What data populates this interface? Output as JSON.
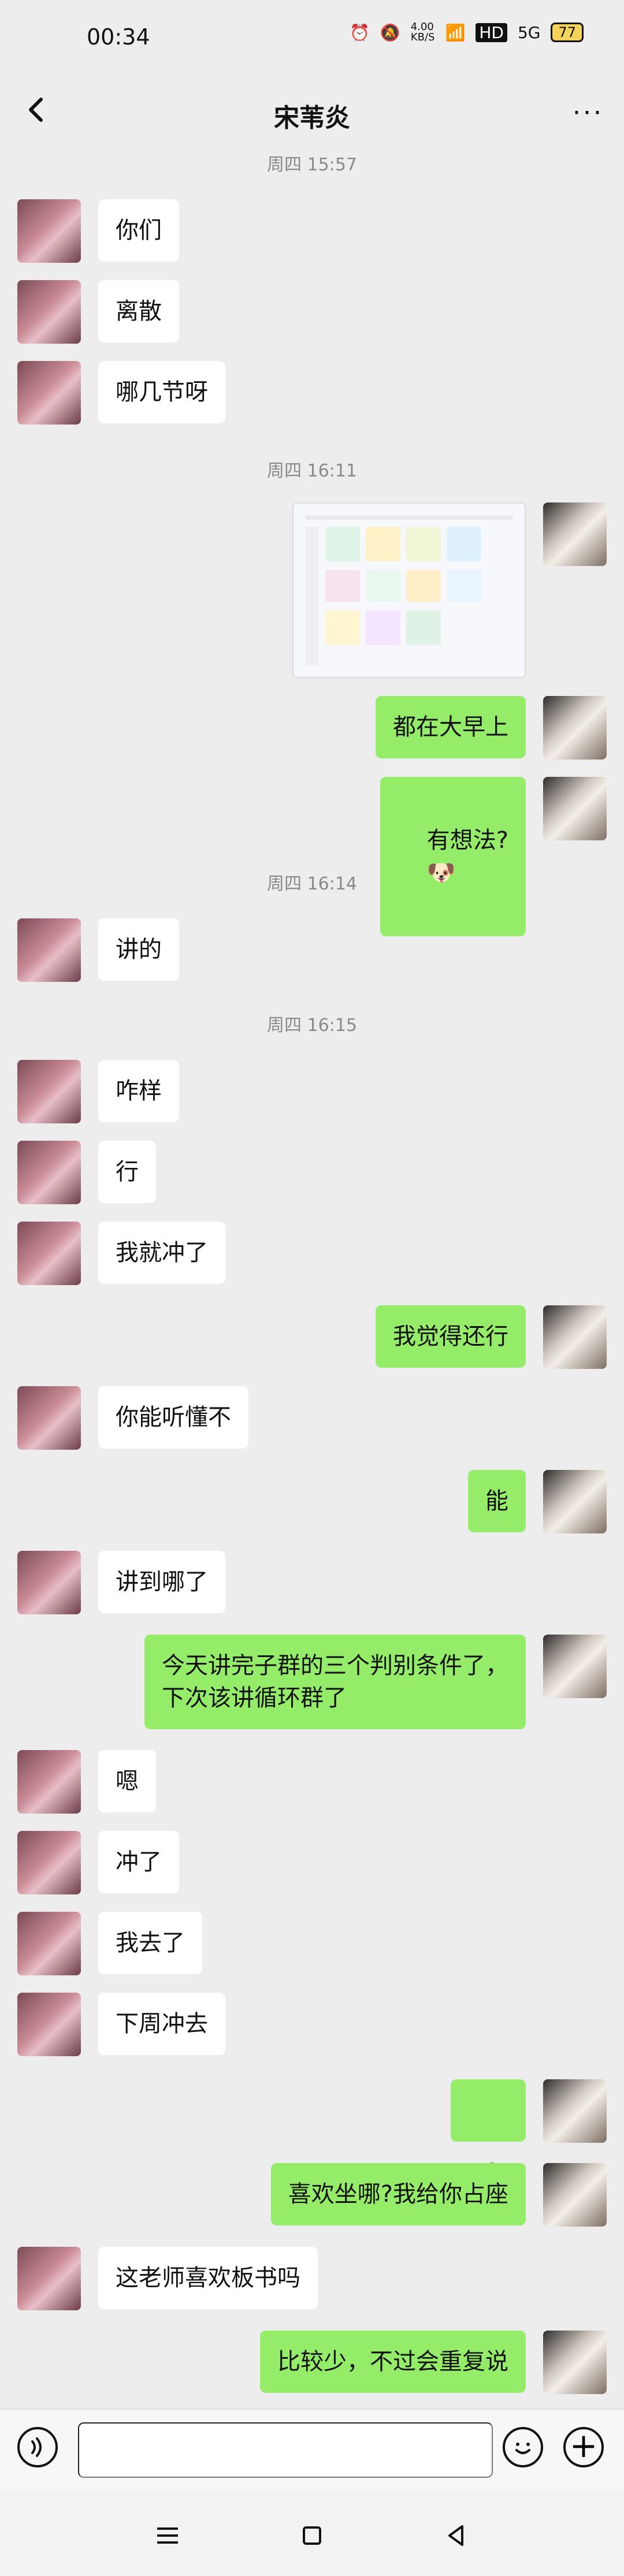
{
  "status": {
    "time": "00:34",
    "net_speed": "4.00\nKB/S",
    "network": "5G",
    "battery": "77"
  },
  "header": {
    "title": "宋苇炎",
    "more": "···"
  },
  "messages": [
    {
      "type": "time",
      "text": "周四 15:57"
    },
    {
      "type": "left",
      "text": "你们"
    },
    {
      "type": "left",
      "text": "离散"
    },
    {
      "type": "left",
      "text": "哪几节呀"
    },
    {
      "type": "time",
      "text": "周四 16:11"
    },
    {
      "type": "image",
      "alt": "schedule screenshot"
    },
    {
      "type": "right",
      "text": "都在大早上"
    },
    {
      "type": "right",
      "text": "有想法?"
    },
    {
      "type": "time",
      "text": "周四 16:14"
    },
    {
      "type": "left",
      "text": "讲的"
    },
    {
      "type": "time",
      "text": "周四 16:15"
    },
    {
      "type": "left",
      "text": "咋样"
    },
    {
      "type": "left",
      "text": "行"
    },
    {
      "type": "left",
      "text": "我就冲了"
    },
    {
      "type": "right",
      "text": "我觉得还行"
    },
    {
      "type": "left",
      "text": "你能听懂不"
    },
    {
      "type": "right",
      "text": "能"
    },
    {
      "type": "left",
      "text": "讲到哪了"
    },
    {
      "type": "right",
      "text": "今天讲完子群的三个判别条件了，\n下次该讲循环群了"
    },
    {
      "type": "left",
      "text": "嗯"
    },
    {
      "type": "left",
      "text": "冲了"
    },
    {
      "type": "left",
      "text": "我去了"
    },
    {
      "type": "left",
      "text": "下周冲去"
    },
    {
      "type": "right",
      "text": ""
    },
    {
      "type": "right",
      "text": "喜欢坐哪?我给你占座"
    },
    {
      "type": "left",
      "text": "这老师喜欢板书吗"
    },
    {
      "type": "right",
      "text": "比较少，不过会重复说"
    }
  ],
  "input": {
    "placeholder": ""
  },
  "icons": {
    "back": "back-icon",
    "voice": "voice-icon",
    "emoji": "emoji-icon",
    "plus": "plus-icon",
    "nav_menu": "menu-icon",
    "nav_home": "home-icon",
    "nav_back": "triangle-back-icon"
  }
}
